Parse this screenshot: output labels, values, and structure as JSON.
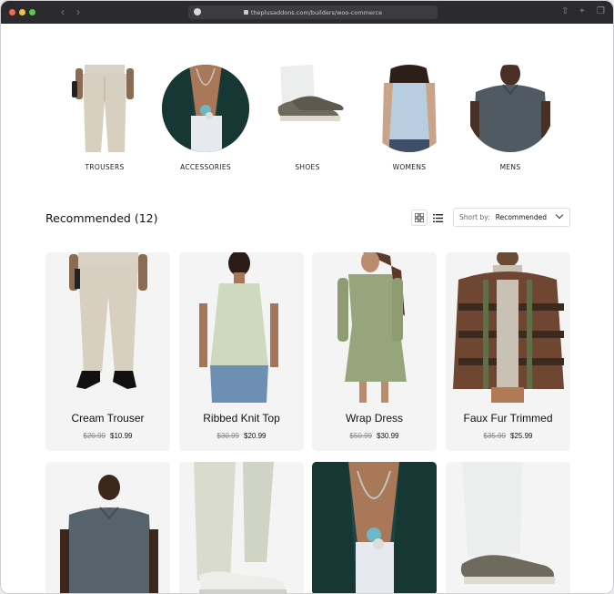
{
  "browser": {
    "url": "theplusaddons.com/builders/woo-commerce"
  },
  "categories": [
    {
      "label": "TROUSERS"
    },
    {
      "label": "ACCESSORIES"
    },
    {
      "label": "SHOES"
    },
    {
      "label": "WOMENS"
    },
    {
      "label": "MENS"
    }
  ],
  "toolbar": {
    "title": "Recommended (12)",
    "sort_label": "Short by:",
    "sort_value": "Recommended"
  },
  "products": [
    {
      "name": "Cream Trouser",
      "old_price": "$20.99",
      "price": "$10.99"
    },
    {
      "name": "Ribbed Knit Top",
      "old_price": "$30.99",
      "price": "$20.99"
    },
    {
      "name": "Wrap Dress",
      "old_price": "$50.99",
      "price": "$30.99"
    },
    {
      "name": "Faux Fur Trimmed",
      "old_price": "$35.99",
      "price": "$25.99"
    },
    {
      "name": "",
      "old_price": "",
      "price": ""
    },
    {
      "name": "",
      "old_price": "",
      "price": ""
    },
    {
      "name": "",
      "old_price": "",
      "price": ""
    },
    {
      "name": "",
      "old_price": "",
      "price": ""
    }
  ],
  "colors": {
    "card_bg": "#f4f4f4",
    "chrome_bg": "#2b2b2f",
    "dot_red": "#ec6a5e",
    "dot_yellow": "#f4be4f",
    "dot_green": "#61c554"
  }
}
